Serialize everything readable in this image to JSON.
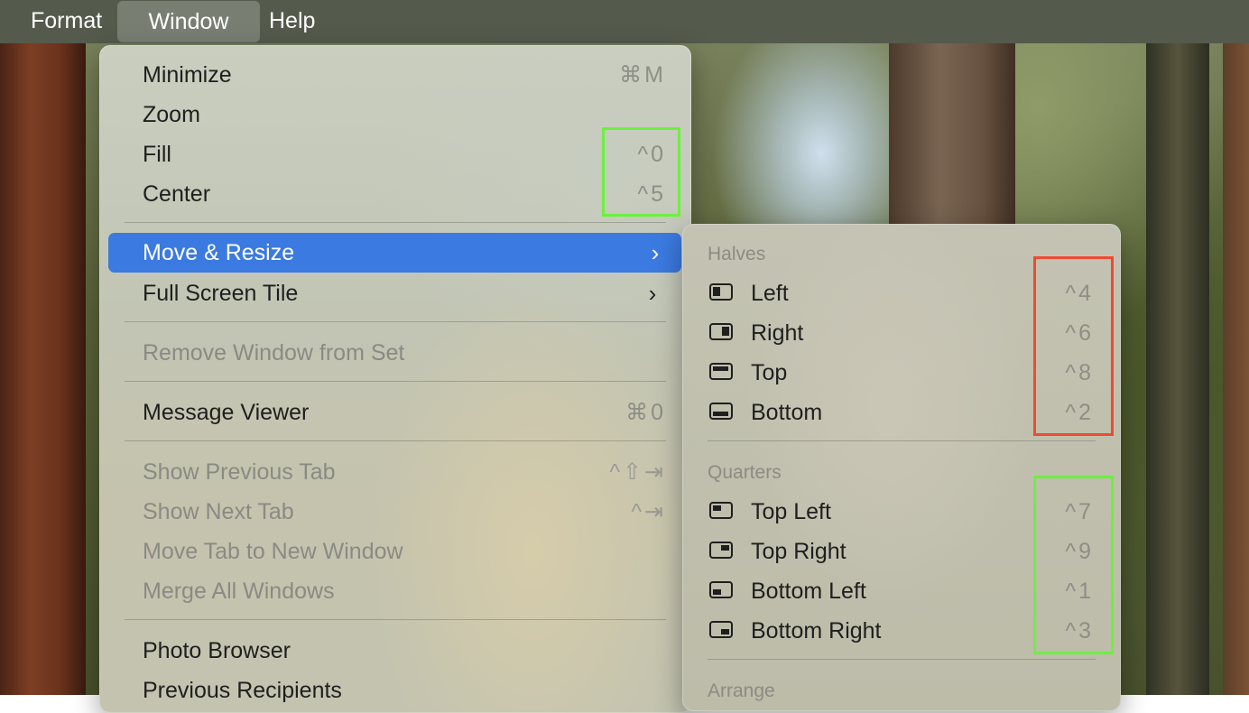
{
  "menubar": {
    "items": [
      "Format",
      "Window",
      "Help"
    ]
  },
  "window_menu": {
    "items": [
      {
        "label": "Minimize",
        "shortcut": "⌘M"
      },
      {
        "label": "Zoom",
        "shortcut": ""
      },
      {
        "label": "Fill",
        "shortcut": "^0"
      },
      {
        "label": "Center",
        "shortcut": "^5"
      },
      {
        "label": "Move & Resize",
        "submenu": true,
        "selected": true
      },
      {
        "label": "Full Screen Tile",
        "submenu": true
      },
      {
        "label": "Remove Window from Set",
        "disabled": true
      },
      {
        "label": "Message Viewer",
        "shortcut": "⌘0"
      },
      {
        "label": "Show Previous Tab",
        "shortcut": "^⇧⇥",
        "disabled": true
      },
      {
        "label": "Show Next Tab",
        "shortcut": "^⇥",
        "disabled": true
      },
      {
        "label": "Move Tab to New Window",
        "disabled": true
      },
      {
        "label": "Merge All Windows",
        "disabled": true
      },
      {
        "label": "Photo Browser"
      },
      {
        "label": "Previous Recipients"
      }
    ]
  },
  "move_resize_submenu": {
    "halves_header": "Halves",
    "halves": [
      {
        "label": "Left",
        "shortcut": "^4",
        "icon": "window-left-half-icon"
      },
      {
        "label": "Right",
        "shortcut": "^6",
        "icon": "window-right-half-icon"
      },
      {
        "label": "Top",
        "shortcut": "^8",
        "icon": "window-top-half-icon"
      },
      {
        "label": "Bottom",
        "shortcut": "^2",
        "icon": "window-bottom-half-icon"
      }
    ],
    "quarters_header": "Quarters",
    "quarters": [
      {
        "label": "Top Left",
        "shortcut": "^7",
        "icon": "window-top-left-quarter-icon"
      },
      {
        "label": "Top Right",
        "shortcut": "^9",
        "icon": "window-top-right-quarter-icon"
      },
      {
        "label": "Bottom Left",
        "shortcut": "^1",
        "icon": "window-bottom-left-quarter-icon"
      },
      {
        "label": "Bottom Right",
        "shortcut": "^3",
        "icon": "window-bottom-right-quarter-icon"
      }
    ],
    "arrange_header": "Arrange"
  },
  "colors": {
    "selection": "#3b7ae0",
    "highlight_green": "#6bf13c",
    "highlight_red": "#f04a32"
  }
}
